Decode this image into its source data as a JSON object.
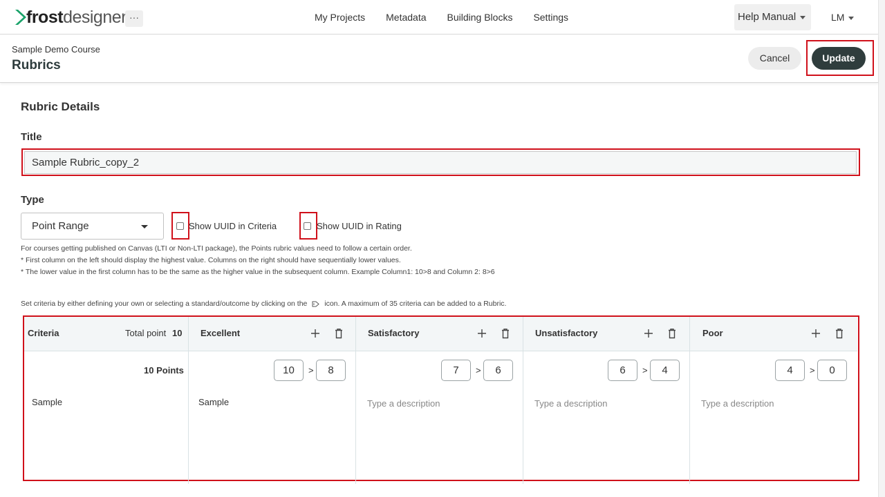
{
  "nav": {
    "brand_bold": "frost",
    "brand_light": "designer",
    "more_label": "···",
    "links": [
      "My Projects",
      "Metadata",
      "Building Blocks",
      "Settings"
    ],
    "help_label": "Help Manual",
    "user_label": "LM"
  },
  "header": {
    "course": "Sample Demo Course",
    "title": "Rubrics",
    "cancel_label": "Cancel",
    "update_label": "Update"
  },
  "form": {
    "section_title": "Rubric Details",
    "title_label": "Title",
    "title_value": "Sample Rubric_copy_2",
    "type_label": "Type",
    "type_value": "Point Range",
    "show_uuid_criteria": "Show UUID in Criteria",
    "show_uuid_rating": "Show UUID in Rating",
    "notes": [
      "For courses getting published on Canvas (LTI or Non-LTI package), the Points rubric values need to follow a certain order.",
      "* First column on the left should display the highest value. Columns on the right should have sequentially lower values.",
      "* The lower value in the first column has to be the same as the higher value in the subsequent column. Example Column1: 10>8 and Column 2: 8>6"
    ],
    "criteria_hint_before": "Set criteria by either defining your own or selecting a standard/outcome by clicking on the",
    "criteria_hint_after": "icon. A maximum of 35 criteria can be added to a Rubric."
  },
  "table": {
    "criteria_header": "Criteria",
    "total_label": "Total point",
    "total_value": "10",
    "ratings": [
      {
        "name": "Excellent",
        "high": "10",
        "low": "8",
        "description": "Sample"
      },
      {
        "name": "Satisfactory",
        "high": "7",
        "low": "6",
        "description": ""
      },
      {
        "name": "Unsatisfactory",
        "high": "6",
        "low": "4",
        "description": ""
      },
      {
        "name": "Poor",
        "high": "4",
        "low": "0",
        "description": ""
      }
    ],
    "row": {
      "points_value": "10",
      "points_label": "Points",
      "criteria_text": "Sample"
    },
    "gt_symbol": ">",
    "desc_placeholder": "Type a description"
  },
  "colors": {
    "accent_dark": "#2f3d3d",
    "highlight_red": "#d0101a"
  }
}
